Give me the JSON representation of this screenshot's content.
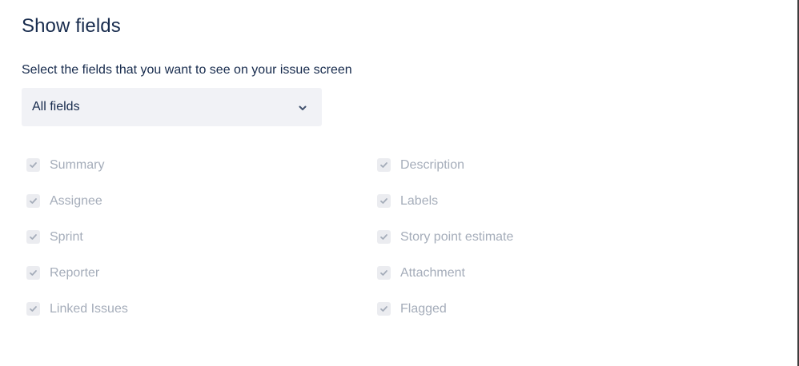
{
  "page": {
    "title": "Show fields",
    "subtitle": "Select the fields that you want to see on your issue screen"
  },
  "select": {
    "value": "All fields",
    "icon": "chevron-down-icon"
  },
  "fields": {
    "left": [
      {
        "label": "Summary",
        "checked": true,
        "disabled": true
      },
      {
        "label": "Assignee",
        "checked": true,
        "disabled": true
      },
      {
        "label": "Sprint",
        "checked": true,
        "disabled": true
      },
      {
        "label": "Reporter",
        "checked": true,
        "disabled": true
      },
      {
        "label": "Linked Issues",
        "checked": true,
        "disabled": true
      }
    ],
    "right": [
      {
        "label": "Description",
        "checked": true,
        "disabled": true
      },
      {
        "label": "Labels",
        "checked": true,
        "disabled": true
      },
      {
        "label": "Story point estimate",
        "checked": true,
        "disabled": true
      },
      {
        "label": "Attachment",
        "checked": true,
        "disabled": true
      },
      {
        "label": "Flagged",
        "checked": true,
        "disabled": true
      }
    ]
  },
  "colors": {
    "heading": "#172b4d",
    "select_bg": "#f1f2f6",
    "disabled_text": "#a5adba",
    "checkbox_bg": "#ebecf0",
    "check_mark": "#a5adba"
  }
}
